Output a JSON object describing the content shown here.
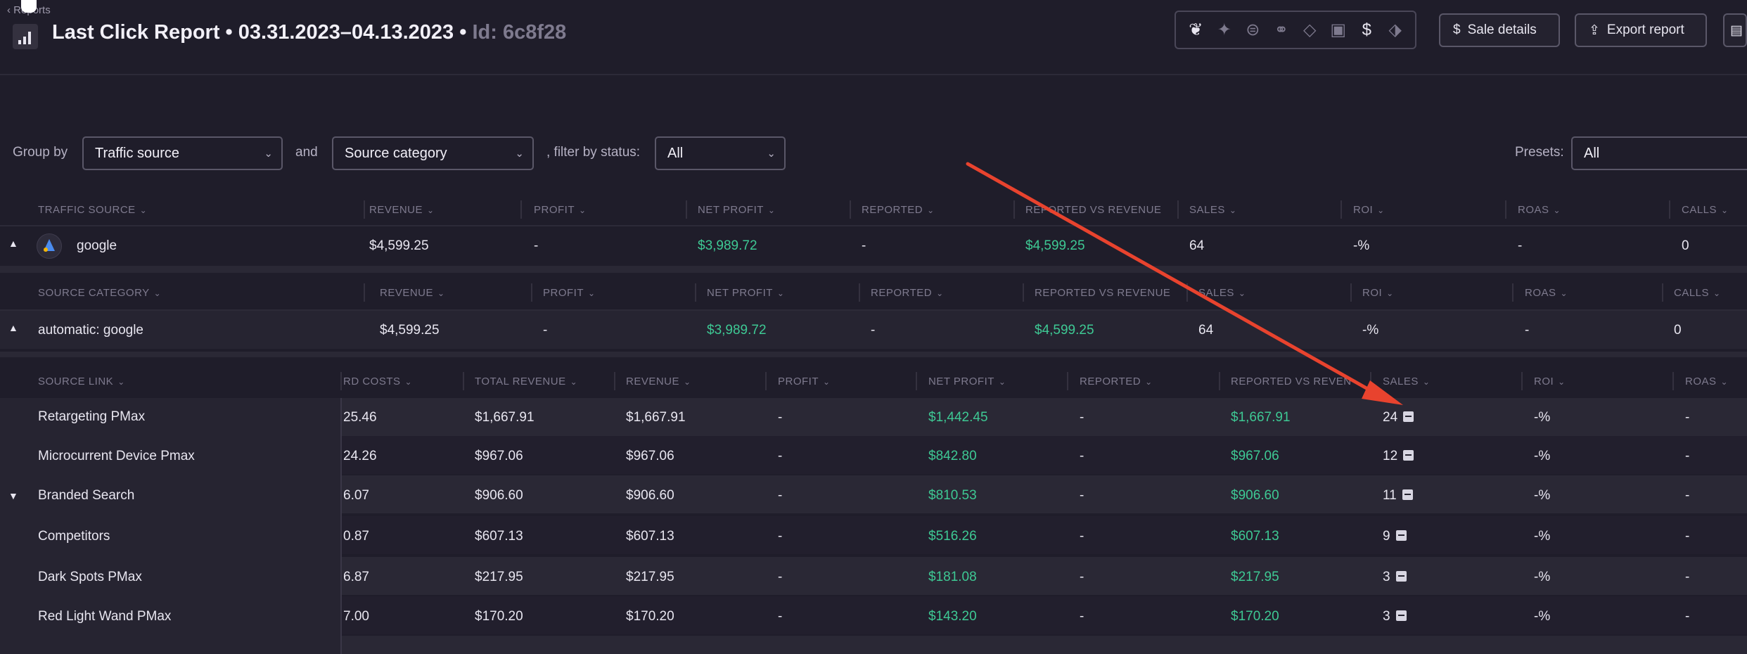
{
  "header": {
    "back_label": "Reports",
    "title": "Last Click Report • 03.31.2023–04.13.2023 •",
    "report_id": "Id: 6c8f28",
    "sale_details_label": "Sale details",
    "export_label": "Export report",
    "icons": [
      "leaf-icon",
      "click-icon",
      "dollar-circle-icon",
      "link-icon",
      "tag-icon",
      "calendar-icon",
      "dollar-icon",
      "price-tag-icon"
    ]
  },
  "filters": {
    "group_by_label": "Group by",
    "group_by_value": "Traffic source",
    "and_label": "and",
    "second_value": "Source category",
    "status_label": ", filter by status:",
    "status_value": "All",
    "presets_label": "Presets:",
    "presets_value": "All"
  },
  "traffic_table": {
    "headers": [
      "TRAFFIC SOURCE",
      "REVENUE",
      "PROFIT",
      "NET PROFIT",
      "REPORTED",
      "REPORTED VS REVENUE",
      "SALES",
      "ROI",
      "ROAS",
      "CALLS"
    ],
    "row": [
      "google",
      "$4,599.25",
      "-",
      "$3,989.72",
      "-",
      "$4,599.25",
      "64",
      "-%",
      "-",
      "0"
    ]
  },
  "category_table": {
    "headers": [
      "SOURCE CATEGORY",
      "REVENUE",
      "PROFIT",
      "NET PROFIT",
      "REPORTED",
      "REPORTED VS REVENUE",
      "SALES",
      "ROI",
      "ROAS",
      "CALLS"
    ],
    "row": [
      "automatic: google",
      "$4,599.25",
      "-",
      "$3,989.72",
      "-",
      "$4,599.25",
      "64",
      "-%",
      "-",
      "0"
    ]
  },
  "link_table": {
    "headers": [
      "SOURCE LINK",
      "RD COSTS",
      "TOTAL REVENUE",
      "REVENUE",
      "PROFIT",
      "NET PROFIT",
      "REPORTED",
      "REPORTED VS REVEN",
      "SALES",
      "ROI",
      "ROAS"
    ],
    "rows": [
      [
        "Retargeting PMax",
        "25.46",
        "$1,667.91",
        "$1,667.91",
        "-",
        "$1,442.45",
        "-",
        "$1,667.91",
        "24",
        "-%",
        "-"
      ],
      [
        "Microcurrent Device Pmax",
        "24.26",
        "$967.06",
        "$967.06",
        "-",
        "$842.80",
        "-",
        "$967.06",
        "12",
        "-%",
        "-"
      ],
      [
        "Branded Search",
        "6.07",
        "$906.60",
        "$906.60",
        "-",
        "$810.53",
        "-",
        "$906.60",
        "11",
        "-%",
        "-"
      ],
      [
        "Competitors",
        "0.87",
        "$607.13",
        "$607.13",
        "-",
        "$516.26",
        "-",
        "$607.13",
        "9",
        "-%",
        "-"
      ],
      [
        "Dark Spots PMax",
        "6.87",
        "$217.95",
        "$217.95",
        "-",
        "$181.08",
        "-",
        "$217.95",
        "3",
        "-%",
        "-"
      ],
      [
        "Red Light Wand PMax",
        "7.00",
        "$170.20",
        "$170.20",
        "-",
        "$143.20",
        "-",
        "$170.20",
        "3",
        "-%",
        "-"
      ]
    ]
  },
  "colors": {
    "background": "#1f1d2a",
    "positive": "#3ec994",
    "annotation_arrow": "#e8432e"
  }
}
